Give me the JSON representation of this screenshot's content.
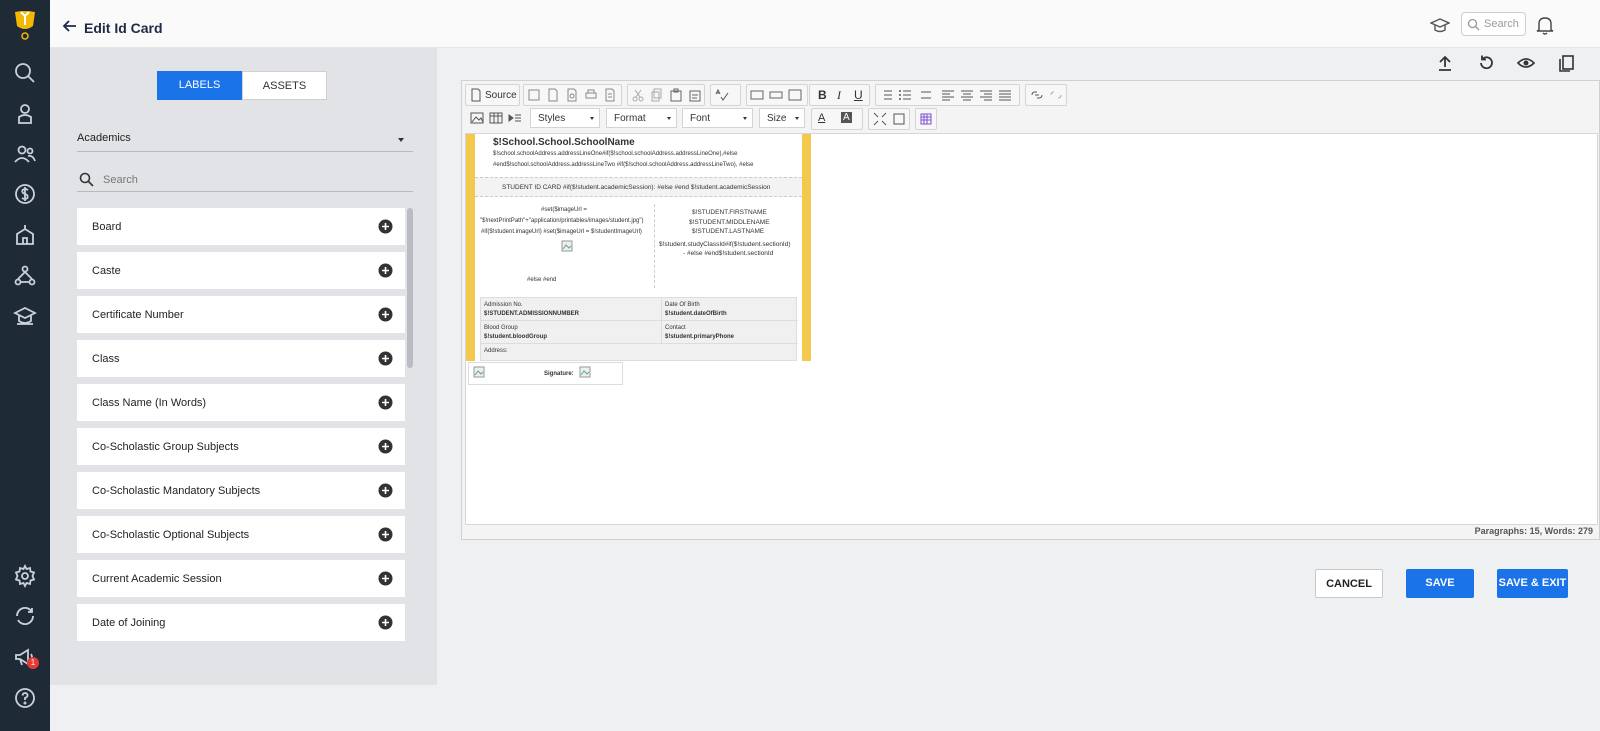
{
  "header": {
    "title": "Edit Id Card",
    "search_placeholder": "Search"
  },
  "notifications": {
    "badge_count": "1"
  },
  "tabs": [
    {
      "label": "LABELS",
      "active": true
    },
    {
      "label": "ASSETS",
      "active": false
    }
  ],
  "category": {
    "selected": "Academics"
  },
  "panel_search": {
    "placeholder": "Search"
  },
  "labels": [
    "Board",
    "Caste",
    "Certificate Number",
    "Class",
    "Class Name (In Words)",
    "Co-Scholastic Group Subjects",
    "Co-Scholastic Mandatory Subjects",
    "Co-Scholastic Optional Subjects",
    "Current Academic Session",
    "Date of Joining"
  ],
  "toolbar": {
    "source_label": "Source",
    "styles_label": "Styles",
    "format_label": "Format",
    "font_label": "Font",
    "size_label": "Size"
  },
  "card": {
    "school_name": "$!School.School.SchoolName",
    "address_line1": "$!school.schoolAddress.addressLineOne#if($!school.schoolAddress.addressLineOne),#else",
    "address_line2": "#end$!school.schoolAddress.addressLineTwo #if($!school.schoolAddress.addressLineTwo), #else",
    "id_title": "STUDENT ID CARD #if($!student.academicSession): #else #end $!student.academicSession",
    "img_line1": "#set($imageUrl =",
    "img_line2": "\"$!nextPrintPath\"+\"application/printables/images/student.jpg\")",
    "img_line3": "#if($!student.imageUrl) #set($imageUrl = $!studentImageUrl)",
    "img_else": "#else #end",
    "first_name": "$!STUDENT.FIRSTNAME",
    "middle_name": "$!STUDENT.MIDDLENAME",
    "last_name": "$!STUDENT.LASTNAME",
    "class_line1": "$!student.studyClassId#if($!student.sectionId)",
    "class_line2": "- #else #end$!student.sectionId",
    "admission_label": "Admission No.",
    "admission_value": "$!STUDENT.ADMISSIONNUMBER",
    "dob_label": "Date Of Birth",
    "dob_value": "$!student.dateOfBirth",
    "blood_label": "Blood Group",
    "blood_value": "$!student.bloodGroup",
    "contact_label": "Contact",
    "contact_value": "$!student.primaryPhone",
    "address_label": "Address:",
    "signature_label": "Signature:"
  },
  "status": {
    "text": "Paragraphs: 15, Words: 279"
  },
  "actions": {
    "cancel": "CANCEL",
    "save": "SAVE",
    "save_exit": "SAVE & EXIT"
  },
  "colors": {
    "sidebar": "#1e2a36",
    "primary": "#1a73e8",
    "card_border": "#f2c94c"
  }
}
